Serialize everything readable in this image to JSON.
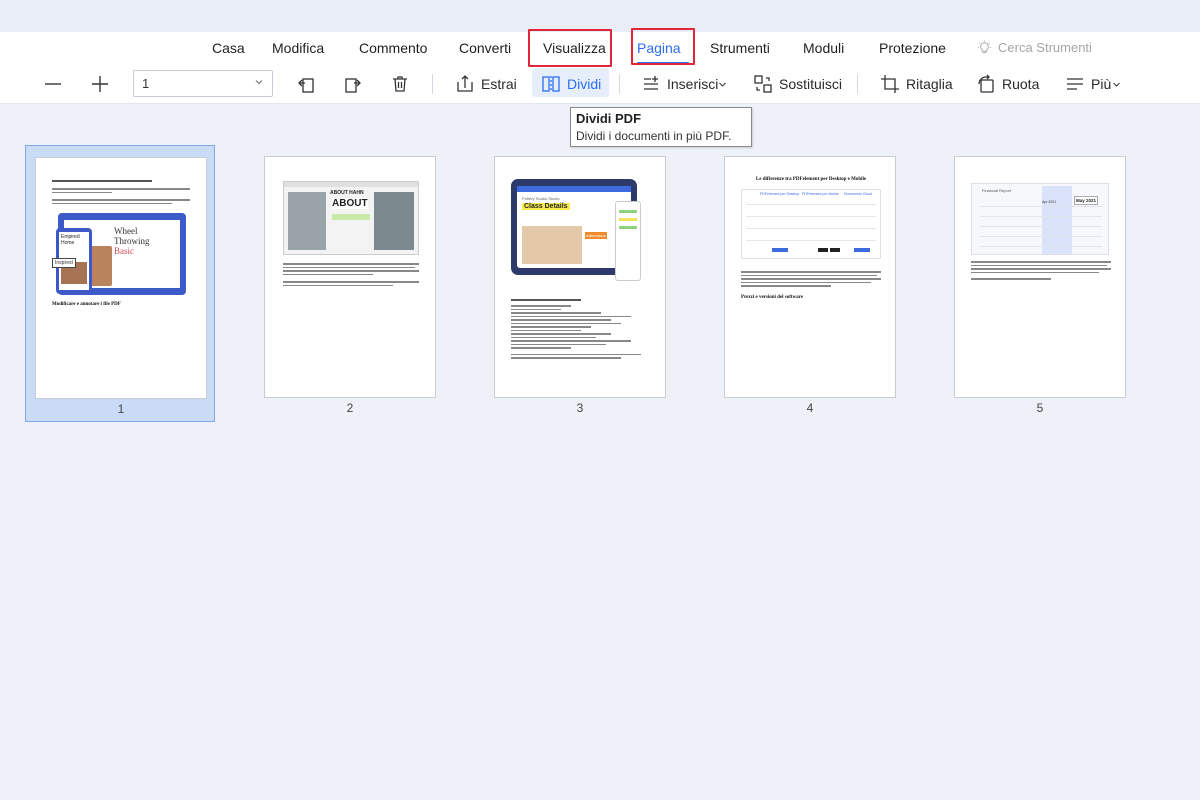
{
  "menu": {
    "items": [
      {
        "id": "casa",
        "label": "Casa"
      },
      {
        "id": "modifica",
        "label": "Modifica"
      },
      {
        "id": "commento",
        "label": "Commento"
      },
      {
        "id": "converti",
        "label": "Converti"
      },
      {
        "id": "visualizza",
        "label": "Visualizza"
      },
      {
        "id": "pagina",
        "label": "Pagina",
        "active": true
      },
      {
        "id": "strumenti",
        "label": "Strumenti"
      },
      {
        "id": "moduli",
        "label": "Moduli"
      },
      {
        "id": "protezione",
        "label": "Protezione"
      }
    ],
    "search_tools_label": "Cerca Strumenti"
  },
  "toolbar": {
    "page_select_value": "1",
    "estrai_label": "Estrai",
    "dividi_label": "Dividi",
    "inserisci_label": "Inserisci",
    "sostituisci_label": "Sostituisci",
    "ritaglia_label": "Ritaglia",
    "ruota_label": "Ruota",
    "piu_label": "Più"
  },
  "tooltip": {
    "title": "Dividi PDF",
    "description": "Dividi i documenti in più PDF."
  },
  "thumbnails": [
    {
      "number": "1",
      "selected": true
    },
    {
      "number": "2",
      "selected": false
    },
    {
      "number": "3",
      "selected": false
    },
    {
      "number": "4",
      "selected": false
    },
    {
      "number": "5",
      "selected": false
    }
  ],
  "page_content": {
    "p1_image_text_1": "Wheel",
    "p1_image_text_2": "Throwing",
    "p1_image_text_3": "Basic",
    "p1_image_text_4": "Empired Home",
    "p1_image_text_5": "Inspired",
    "p1_heading": "Modificare e annotare i file PDF",
    "p2_about_1": "ABOUT HAHN",
    "p2_about_2": "ABOUT",
    "p3_tablet_text": "Class Details",
    "p3_tablet_sub": "Pottery Studio Studio",
    "p3_tablet_tag": "Attendance",
    "p4_heading": "Le differenze tra PDFelement per Desktop e Mobile",
    "p4_col_1": "PDFelement per Desktop",
    "p4_col_2": "PDFelement per Mobile",
    "p4_col_3": "Documento Cloud",
    "p4_subheading": "Prezzi e versioni del software",
    "p5_header": "Financial Report",
    "p5_tag_1": "Apr 2021",
    "p5_tag_2": "May 2021"
  },
  "colors": {
    "accent": "#2b6ef2",
    "highlight_red": "#e0263a",
    "selected_bg": "#c9dbf6",
    "app_bg": "#eef1f8"
  }
}
